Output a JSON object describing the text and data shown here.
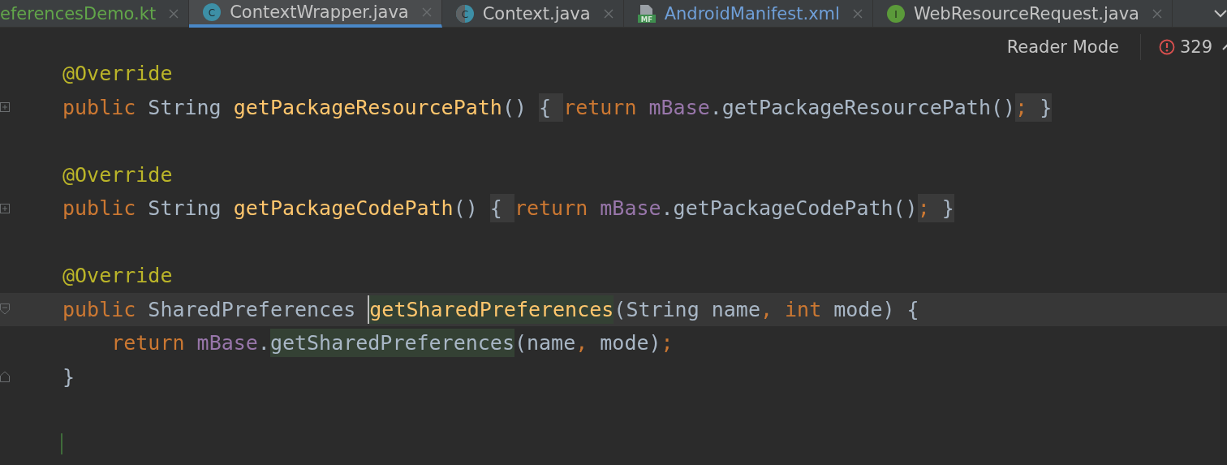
{
  "tabs": [
    {
      "label": "eferencesDemo.kt",
      "kind": "plain",
      "color": "#62a64a",
      "selected": false
    },
    {
      "label": "ContextWrapper.java",
      "kind": "class",
      "badge": "C",
      "color": "#c4c4c4",
      "selected": true
    },
    {
      "label": "Context.java",
      "kind": "abstract-class",
      "badge": "C",
      "color": "#c4c4c4",
      "selected": false
    },
    {
      "label": "AndroidManifest.xml",
      "kind": "manifest",
      "badge": "MF",
      "color": "#6f9fd8",
      "selected": false
    },
    {
      "label": "WebResourceRequest.java",
      "kind": "interface",
      "badge": "I",
      "color": "#c4c4c4",
      "selected": false
    }
  ],
  "toolbar": {
    "reader_mode": "Reader Mode",
    "error_count": "329"
  },
  "lines": [
    {
      "kind": "plain",
      "current": false,
      "changed": false,
      "tokens": [
        {
          "text": "@Override",
          "kind": "annotation"
        }
      ]
    },
    {
      "kind": "folded",
      "current": false,
      "changed": false,
      "tokens": [
        {
          "text": "public",
          "kind": "keyword"
        },
        {
          "text": " String ",
          "kind": "plain"
        },
        {
          "text": "getPackageResourcePath",
          "kind": "method"
        },
        {
          "text": "() ",
          "kind": "plain"
        },
        {
          "text": "{ ",
          "kind": "folded"
        },
        {
          "text": "return ",
          "kind": "keyword"
        },
        {
          "text": "mBase",
          "kind": "field"
        },
        {
          "text": ".getPackageResourcePath()",
          "kind": "plain"
        },
        {
          "text": ";",
          "kind": "folded-sep"
        },
        {
          "text": " }",
          "kind": "folded"
        }
      ]
    },
    {
      "kind": "plain",
      "current": false,
      "changed": false
    },
    {
      "kind": "plain",
      "current": false,
      "changed": false,
      "tokens": [
        {
          "text": "@Override",
          "kind": "annotation"
        }
      ]
    },
    {
      "kind": "folded",
      "current": false,
      "changed": false,
      "tokens": [
        {
          "text": "public",
          "kind": "keyword"
        },
        {
          "text": " String ",
          "kind": "plain"
        },
        {
          "text": "getPackageCodePath",
          "kind": "method"
        },
        {
          "text": "() ",
          "kind": "plain"
        },
        {
          "text": "{ ",
          "kind": "folded"
        },
        {
          "text": "return ",
          "kind": "keyword"
        },
        {
          "text": "mBase",
          "kind": "field"
        },
        {
          "text": ".getPackageCodePath()",
          "kind": "plain"
        },
        {
          "text": ";",
          "kind": "folded-sep"
        },
        {
          "text": " }",
          "kind": "folded"
        }
      ]
    },
    {
      "kind": "plain",
      "current": false,
      "changed": false
    },
    {
      "kind": "plain",
      "current": false,
      "changed": false,
      "tokens": [
        {
          "text": "@Override",
          "kind": "annotation"
        }
      ]
    },
    {
      "kind": "fold-start",
      "current": true,
      "changed": false,
      "tokens": [
        {
          "text": "public",
          "kind": "keyword"
        },
        {
          "text": " SharedPreferences ",
          "kind": "plain"
        },
        {
          "text": "getSharedPreferences",
          "kind": "method-usage-caret"
        },
        {
          "text": "(String name",
          "kind": "plain"
        },
        {
          "text": ", ",
          "kind": "sep"
        },
        {
          "text": "int",
          "kind": "keyword"
        },
        {
          "text": " mode) {",
          "kind": "plain"
        }
      ]
    },
    {
      "kind": "plain",
      "current": false,
      "changed": false,
      "tokens": [
        {
          "text": "    return ",
          "kind": "keyword"
        },
        {
          "text": "mBase",
          "kind": "field"
        },
        {
          "text": ".",
          "kind": "plain"
        },
        {
          "text": "getSharedPreferences",
          "kind": "usage"
        },
        {
          "text": "(name",
          "kind": "plain"
        },
        {
          "text": ", ",
          "kind": "sep"
        },
        {
          "text": "mode)",
          "kind": "plain"
        },
        {
          "text": ";",
          "kind": "sep"
        }
      ]
    },
    {
      "kind": "fold-end",
      "current": false,
      "changed": false,
      "tokens": [
        {
          "text": "}",
          "kind": "plain"
        }
      ]
    },
    {
      "kind": "plain",
      "current": false,
      "changed": false
    },
    {
      "kind": "plain",
      "current": false,
      "changed": true
    }
  ]
}
